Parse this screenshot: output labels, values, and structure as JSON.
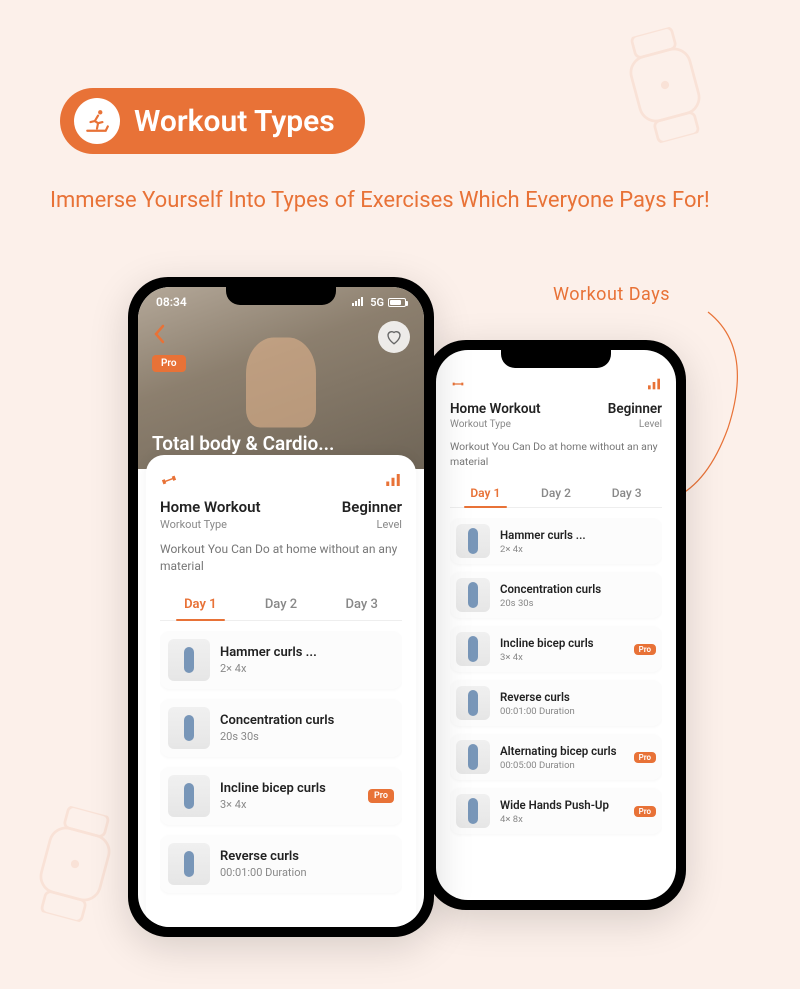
{
  "badge": {
    "title": "Workout Types"
  },
  "subtitle": "Immerse Yourself Into Types of Exercises Which Everyone Pays For!",
  "annotation": "Workout  Days",
  "status": {
    "time": "08:34",
    "network": "5G"
  },
  "hero": {
    "pro": "Pro",
    "title": "Total body & Cardio..."
  },
  "info": {
    "workout_title": "Home Workout",
    "workout_sub": "Workout Type",
    "level_title": "Beginner",
    "level_sub": "Level"
  },
  "desc_front": "Workout You Can Do at home without an any material",
  "desc_back": "Workout You Can Do at home without an any material",
  "tabs": [
    "Day 1",
    "Day 2",
    "Day 3"
  ],
  "pro_label": "Pro",
  "front_exercises": [
    {
      "title": "Hammer curls ...",
      "sub": "2× 4x",
      "pro": false
    },
    {
      "title": "Concentration curls",
      "sub": "20s 30s",
      "pro": false
    },
    {
      "title": "Incline bicep curls",
      "sub": "3× 4x",
      "pro": true
    },
    {
      "title": "Reverse curls",
      "sub": "00:01:00 Duration",
      "pro": false
    }
  ],
  "back_info_workout": "Home Workout",
  "back_info_level": "Beginner",
  "back_exercises": [
    {
      "title": "Hammer curls ...",
      "sub": "2× 4x",
      "pro": false
    },
    {
      "title": "Concentration curls",
      "sub": "20s 30s",
      "pro": false
    },
    {
      "title": "Incline bicep curls",
      "sub": "3× 4x",
      "pro": true
    },
    {
      "title": "Reverse curls",
      "sub": "00:01:00 Duration",
      "pro": false
    },
    {
      "title": "Alternating bicep curls",
      "sub": "00:05:00 Duration",
      "pro": true
    },
    {
      "title": "Wide Hands Push-Up",
      "sub": "4× 8x",
      "pro": true
    }
  ]
}
